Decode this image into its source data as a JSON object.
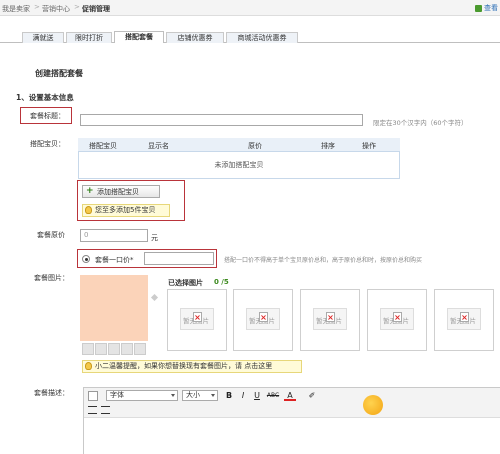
{
  "breadcrumb": {
    "home": "我是卖家",
    "marketing": "营销中心",
    "current": "促销管理",
    "sep": ">"
  },
  "top_right": {
    "label": "查看"
  },
  "tabs": [
    {
      "label": "满就送"
    },
    {
      "label": "限时打折"
    },
    {
      "label": "搭配套餐"
    },
    {
      "label": "店铺优惠券"
    },
    {
      "label": "商城活动优惠券"
    }
  ],
  "page_title": "创建搭配套餐",
  "section_title": "1、设置基本信息",
  "form": {
    "package_title_label": "套餐标题：",
    "package_title_value": "",
    "package_title_hint": "限定在30个汉字内（60个字符）",
    "items_label": "搭配宝贝：",
    "items_table": {
      "headers": [
        "搭配宝贝",
        "显示名",
        "原价",
        "排序",
        "操作"
      ],
      "empty_message": "未添加搭配宝贝"
    },
    "add_item_button": "添加搭配宝贝",
    "add_item_tip": "您至多添加5件宝贝",
    "original_price_label": "套餐原价",
    "original_price_value": "0",
    "original_price_unit": "元",
    "fixed_price_label": "套餐一口价*",
    "fixed_price_value": "",
    "fixed_price_hint": "搭配一口价不得高于单个宝贝原价总和，高于原价总和时，按原价总和购买",
    "images_label": "套餐图片：",
    "selected_images_label": "已选择图片",
    "selected_images_count": "0 /5",
    "placeholder_image_text": "暂无图片",
    "image_tip": "小二温馨提醒，如果你想替换现有套餐图片，请 点击这里",
    "description_label": "套餐描述：",
    "editor": {
      "font_select": "字体",
      "size_select": "大小",
      "bold": "B",
      "italic": "I",
      "underline": "U",
      "strike": "ABC",
      "font_color": "A",
      "highlight": "✐"
    }
  },
  "colors": {
    "highlight_box": "#b9343a",
    "tab_bg": "#eef2f7",
    "table_head_bg": "#e9f0f8",
    "main_image_bg": "#fbd3b9"
  }
}
